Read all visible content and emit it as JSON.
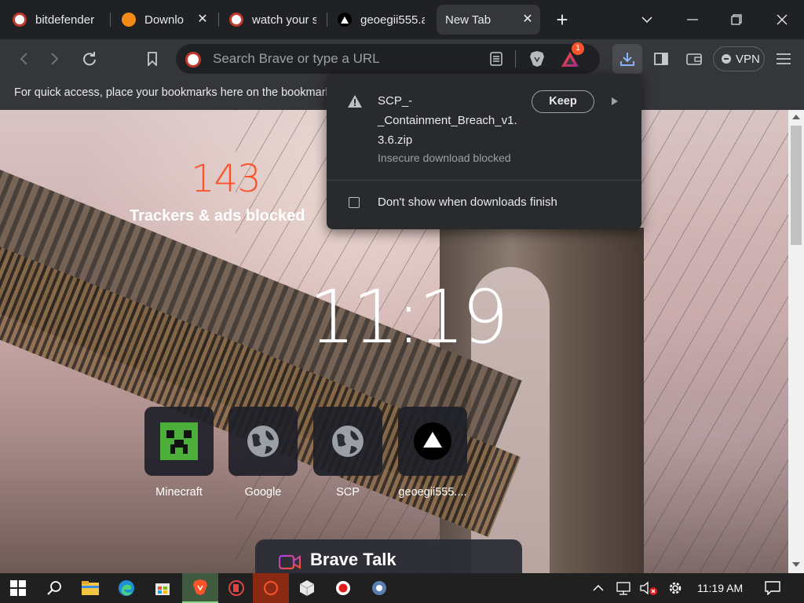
{
  "tabs": [
    {
      "title": "bitdefender",
      "active": false
    },
    {
      "title": "Download",
      "active": false
    },
    {
      "title": "watch your s",
      "active": false
    },
    {
      "title": "geoegii555.a",
      "active": false
    },
    {
      "title": "New Tab",
      "active": true
    }
  ],
  "toolbar": {
    "search_placeholder": "Search Brave or type a URL",
    "rewards_badge": "1",
    "vpn_label": "VPN"
  },
  "bookmarks_bar": {
    "hint": "For quick access, place your bookmarks here on the bookmarks bar."
  },
  "new_tab": {
    "trackers_count": "143",
    "trackers_label": "Trackers & ads blocked",
    "clock": "11:19",
    "top_sites": [
      {
        "label": "Minecraft",
        "icon": "minecraft-creeper-icon"
      },
      {
        "label": "Google",
        "icon": "globe-icon"
      },
      {
        "label": "SCP",
        "icon": "globe-icon"
      },
      {
        "label": "geoegii555....",
        "icon": "triangle-logo-icon"
      }
    ],
    "brave_talk_label": "Brave Talk"
  },
  "download_bubble": {
    "filename": "SCP_-_Containment_Breach_v1.3.6.zip",
    "filename_lines": [
      "SCP_-",
      "_Containment_Breach_v1.",
      "3.6.zip"
    ],
    "status": "Insecure download blocked",
    "keep_label": "Keep",
    "dont_show_label": "Don't show when downloads finish",
    "dont_show_checked": false
  },
  "taskbar": {
    "time": "11:19 AM"
  },
  "colors": {
    "brave_orange": "#fb542b",
    "chrome_dark": "#202124",
    "toolbar": "#35363a"
  }
}
